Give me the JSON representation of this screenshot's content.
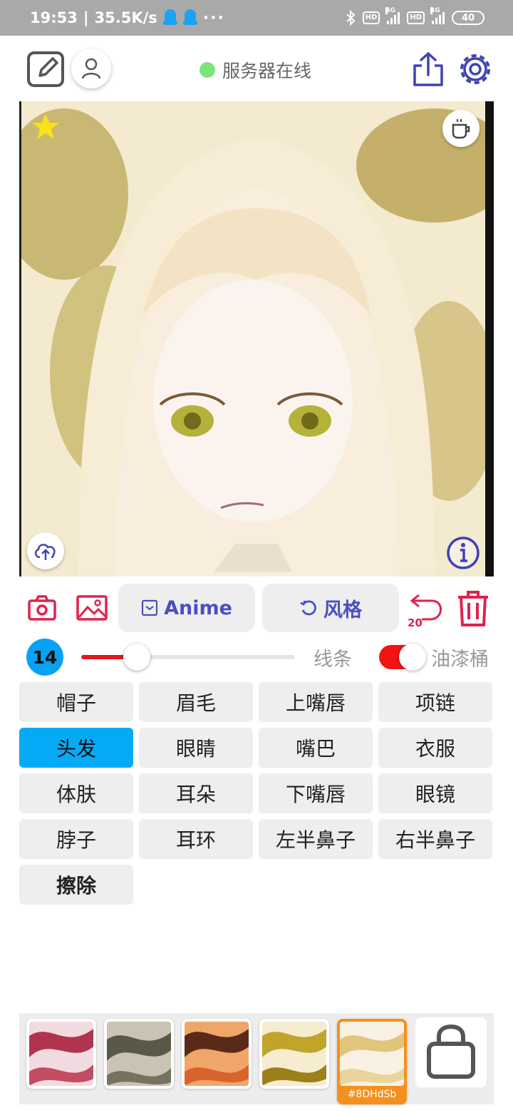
{
  "status_bar": {
    "time": "19:53",
    "separator": "|",
    "network_speed": "35.5K/s",
    "overflow": "···",
    "hd1": "HD",
    "sig1": "4G",
    "hd2": "HD",
    "sig2": "4G",
    "battery": "40"
  },
  "header": {
    "server_status": "服务器在线"
  },
  "toolbar": {
    "anime_label": "Anime",
    "style_label": "风格",
    "undo_count": "20"
  },
  "brush": {
    "size": "14",
    "size_fraction": 0.26,
    "line_label": "线条",
    "bucket_label": "油漆桶",
    "bucket_enabled": true
  },
  "parts": [
    {
      "label": "帽子"
    },
    {
      "label": "眉毛"
    },
    {
      "label": "上嘴唇"
    },
    {
      "label": "项链"
    },
    {
      "label": "头发",
      "selected": true
    },
    {
      "label": "眼睛"
    },
    {
      "label": "嘴巴"
    },
    {
      "label": "衣服"
    },
    {
      "label": "体肤"
    },
    {
      "label": "耳朵"
    },
    {
      "label": "下嘴唇"
    },
    {
      "label": "眼镜"
    },
    {
      "label": "脖子"
    },
    {
      "label": "耳环"
    },
    {
      "label": "左半鼻子"
    },
    {
      "label": "右半鼻子"
    },
    {
      "label": "擦除",
      "bold": true
    }
  ],
  "styles": {
    "selected_caption": "#8DHdSb"
  },
  "colors": {
    "accent": "#4a4fbf",
    "danger": "#e0224e",
    "selected_part": "#05aaf5",
    "server_online": "#7be57b",
    "selected_style": "#f5901e"
  }
}
